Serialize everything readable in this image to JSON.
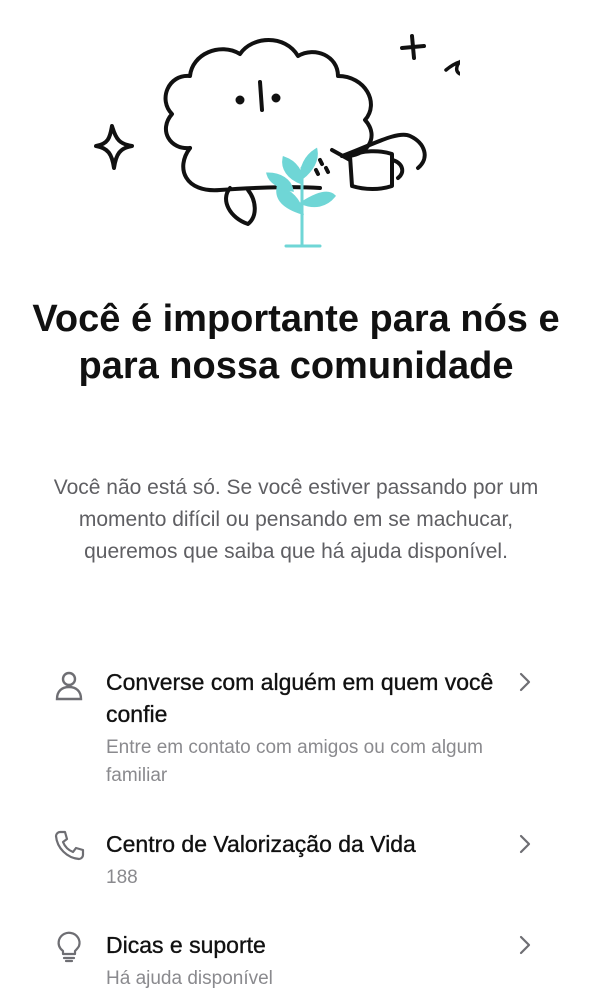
{
  "headline": "Você é importante para nós e para nossa comunidade",
  "subtext": "Você não está só. Se você estiver passando por um momento difícil ou pensando em se machucar, queremos que saiba que há ajuda disponível.",
  "options": [
    {
      "icon": "person-icon",
      "title": "Converse com alguém em quem você confie",
      "description": "Entre em contato com amigos ou com algum familiar"
    },
    {
      "icon": "phone-icon",
      "title": "Centro de Valorização da Vida",
      "description": "188"
    },
    {
      "icon": "lightbulb-icon",
      "title": "Dicas e suporte",
      "description": "Há ajuda disponível"
    }
  ],
  "colors": {
    "text_primary": "#111111",
    "text_secondary": "#5f5f63",
    "text_muted": "#8a8a8e",
    "icon": "#6e6e73",
    "plant_accent": "#6fd6d6"
  }
}
